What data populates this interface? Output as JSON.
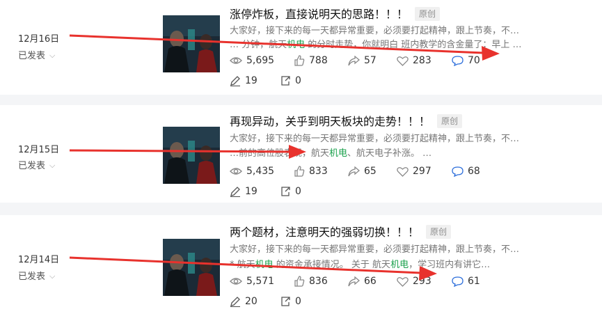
{
  "articles": [
    {
      "date": "12月16日",
      "status": "已发表",
      "title": "涨停炸板，直接说明天的思路！！！",
      "badge": "原创",
      "desc_line1": "大家好，接下来的每一天都异常重要，必须要打起精神，跟上节奏，不…",
      "desc_line2_pre": "… 分钟，航天",
      "desc_line2_hl": "机电",
      "desc_line2_post": " 的分时走势，你就明白 班内教学的含金量了：早上 …",
      "views": "5,695",
      "likes": "788",
      "shares": "57",
      "favorites": "283",
      "comments": "70",
      "edits": "19",
      "reposts": "0"
    },
    {
      "date": "12月15日",
      "status": "已发表",
      "title": "再现异动，关乎到明天板块的走势！！！",
      "badge": "原创",
      "desc_line1": "大家好，接下来的每一天都异常重要，必须要打起精神，跟上节奏，不…",
      "desc_line2_pre": "…前的高位股表现，航天",
      "desc_line2_hl": "机电",
      "desc_line2_post": "、航天电子补涨。 …",
      "views": "5,435",
      "likes": "833",
      "shares": "65",
      "favorites": "297",
      "comments": "68",
      "edits": "19",
      "reposts": "0"
    },
    {
      "date": "12月14日",
      "status": "已发表",
      "title": "两个题材，注意明天的强弱切换！！！",
      "badge": "原创",
      "desc_line1": "大家好，接下来的每一天都异常重要，必须要打起精神，跟上节奏，不…",
      "desc_line2_pre": "* 航天",
      "desc_line2_hl": "机电",
      "desc_line2_post": " 的资金承接情况。 关于 航天",
      "desc_line2_hl2": "机电",
      "desc_line2_post2": "，学习班内有讲它…",
      "views": "5,571",
      "likes": "836",
      "shares": "66",
      "favorites": "293",
      "comments": "61",
      "edits": "20",
      "reposts": "0"
    }
  ],
  "colors": {
    "arrow": "#e8322d",
    "highlight": "#19a04b",
    "accent": "#2c6edb"
  }
}
